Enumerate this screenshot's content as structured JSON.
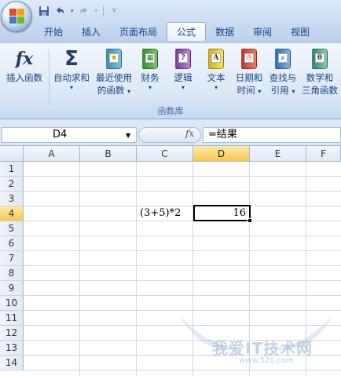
{
  "qat": {
    "save": "save-icon",
    "undo": "undo-icon",
    "redo": "redo-icon",
    "customize": "customize-icon"
  },
  "tabs": [
    {
      "label": "开始"
    },
    {
      "label": "插入"
    },
    {
      "label": "页面布局"
    },
    {
      "label": "公式"
    },
    {
      "label": "数据"
    },
    {
      "label": "审阅"
    },
    {
      "label": "视图"
    }
  ],
  "active_tab": "公式",
  "ribbon": {
    "insert_function": {
      "line1": "插入函数",
      "icon_glyph": "fx"
    },
    "autosum": {
      "line1": "自动求和",
      "icon_glyph": "Σ"
    },
    "recent": {
      "line1": "最近使用",
      "line2": "的函数"
    },
    "financial": {
      "line1": "财务"
    },
    "logical": {
      "line1": "逻辑",
      "icon_glyph": "?"
    },
    "text": {
      "line1": "文本",
      "icon_glyph": "A"
    },
    "datetime": {
      "line1": "日期和",
      "line2": "时间"
    },
    "lookup": {
      "line1": "查找与",
      "line2": "引用"
    },
    "math": {
      "line1": "数学和",
      "line2": "三角函数",
      "icon_glyph": "θ"
    },
    "group_label": "函数库"
  },
  "formula_bar": {
    "name_box": "D4",
    "fx": "fx",
    "formula": "=结果"
  },
  "columns": [
    "A",
    "B",
    "C",
    "D",
    "E",
    "F"
  ],
  "rows": [
    "1",
    "2",
    "3",
    "4",
    "5",
    "6",
    "7",
    "8",
    "9",
    "10",
    "11",
    "12",
    "13",
    "14"
  ],
  "cells": {
    "C4": "(3+5)*2",
    "D4": "16"
  },
  "watermark": {
    "text": "我爱IT技术网",
    "url": "www.52ij.com"
  },
  "colors": {
    "accent": "#15428b",
    "selected_header": "#f9c94c",
    "ribbon_bg": "#dbe7f5"
  }
}
